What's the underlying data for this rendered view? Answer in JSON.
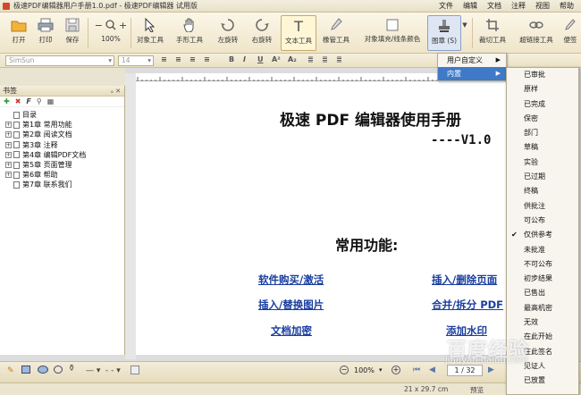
{
  "titlebar": {
    "title": "极速PDF编辑器用户手册1.0.pdf - 极速PDF编辑器 试用版",
    "menu": [
      "文件",
      "编辑",
      "文档",
      "注释",
      "视图",
      "帮助"
    ]
  },
  "toolbar": {
    "open": "打开",
    "print": "打印",
    "save": "保存",
    "zoom": "100%",
    "object_tool": "对象工具",
    "hand_tool": "手形工具",
    "rotate_left": "左旋转",
    "rotate_right": "右旋转",
    "text_tool": "文本工具",
    "eraser": "橡管工具",
    "fill_tool": "对象填充/线条颜色",
    "stamp": "图章 (S)",
    "crop": "裁切工具",
    "link": "超链接工具",
    "note": "便签"
  },
  "fontbar": {
    "font": "SimSun",
    "size": "14"
  },
  "sidebar": {
    "title": "书签",
    "pin": "ₒ ✕",
    "tool_icons": [
      "plus-icon",
      "delete-icon",
      "find-icon",
      "search-icon",
      "properties-icon"
    ],
    "items": [
      {
        "label": "目录",
        "expandable": false
      },
      {
        "label": "第1章 常用功能",
        "expandable": true
      },
      {
        "label": "第2章 阅读文档",
        "expandable": true
      },
      {
        "label": "第3章 注释",
        "expandable": true
      },
      {
        "label": "第4章 编辑PDF文档",
        "expandable": true
      },
      {
        "label": "第5章 页面管理",
        "expandable": true
      },
      {
        "label": "第6章 帮助",
        "expandable": true
      },
      {
        "label": "第7章 联系我们",
        "expandable": false
      }
    ]
  },
  "document": {
    "title": "极速 PDF 编辑器使用手册",
    "version": "----V1.0",
    "subtitle": "常用功能:",
    "links": [
      "软件购买/激活",
      "插入/删除页面",
      "插入/替换图片",
      "合并/拆分 PDF",
      "文档加密",
      "添加水印"
    ]
  },
  "stamp_menu": {
    "items": [
      "用户自定义",
      "内置"
    ]
  },
  "builtin_menu": {
    "items": [
      "已审批",
      "原样",
      "已完成",
      "保密",
      "部门",
      "草稿",
      "实验",
      "已过期",
      "终稿",
      "供批注",
      "可公布",
      "仅供参考",
      "未批准",
      "不可公布",
      "初步结果",
      "已售出",
      "最高机密",
      "无效",
      "在此开始",
      "在此签名",
      "见证人",
      "已放置"
    ],
    "checked": "仅供参考"
  },
  "statusbar": {
    "zoom": "100%",
    "page": "1 / 32"
  },
  "bottombar": {
    "size": "21 x 29.7 cm",
    "mode": "预览"
  },
  "watermark": {
    "text": "百度经验",
    "url": "jingyan.baidu.com"
  },
  "colors": {
    "ribbon": "#efe5c9",
    "link": "#1a3ea0",
    "highlight": "#3f7ac8"
  }
}
